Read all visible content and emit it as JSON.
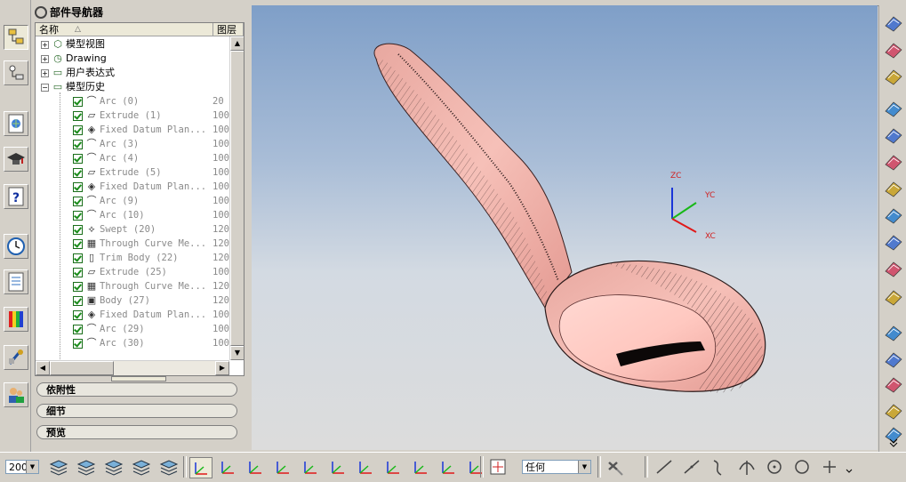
{
  "navigator": {
    "title": "部件导航器",
    "columns": {
      "name": "名称",
      "sort_indicator": "△",
      "layer": "图层"
    },
    "groups": [
      {
        "label": "模型视图",
        "expander": "+"
      },
      {
        "label": "Drawing",
        "expander": "+"
      },
      {
        "label": "用户表达式",
        "expander": "+"
      },
      {
        "label": "模型历史",
        "expander": "−"
      }
    ],
    "features": [
      {
        "name": "Arc (0)",
        "layer": "20",
        "icon": "arc-icon"
      },
      {
        "name": "Extrude (1)",
        "layer": "100",
        "icon": "extrude-icon"
      },
      {
        "name": "Fixed Datum Plan...",
        "layer": "100",
        "icon": "datum-plane-icon"
      },
      {
        "name": "Arc (3)",
        "layer": "100",
        "icon": "arc-icon"
      },
      {
        "name": "Arc (4)",
        "layer": "100",
        "icon": "arc-icon"
      },
      {
        "name": "Extrude (5)",
        "layer": "100",
        "icon": "extrude-icon"
      },
      {
        "name": "Fixed Datum Plan...",
        "layer": "100",
        "icon": "datum-plane-icon"
      },
      {
        "name": "Arc (9)",
        "layer": "100",
        "icon": "arc-icon"
      },
      {
        "name": "Arc (10)",
        "layer": "100",
        "icon": "arc-icon"
      },
      {
        "name": "Swept (20)",
        "layer": "120",
        "icon": "swept-icon"
      },
      {
        "name": "Through Curve Me...",
        "layer": "120",
        "icon": "through-curve-mesh-icon"
      },
      {
        "name": "Trim Body (22)",
        "layer": "120",
        "icon": "trim-body-icon"
      },
      {
        "name": "Extrude (25)",
        "layer": "100",
        "icon": "extrude-icon"
      },
      {
        "name": "Through Curve Me...",
        "layer": "120",
        "icon": "through-curve-mesh-icon"
      },
      {
        "name": "Body (27)",
        "layer": "120",
        "icon": "body-icon"
      },
      {
        "name": "Fixed Datum Plan...",
        "layer": "100",
        "icon": "datum-plane-icon"
      },
      {
        "name": "Arc (29)",
        "layer": "100",
        "icon": "arc-icon"
      },
      {
        "name": "Arc (30)",
        "layer": "100",
        "icon": "arc-icon"
      }
    ],
    "sections": [
      "依附性",
      "细节",
      "预览"
    ]
  },
  "viewport": {
    "csys_labels": {
      "z": "ZC",
      "y": "YC",
      "x": "XC"
    },
    "axis_colors": {
      "z": "#1a35d8",
      "y": "#18b818",
      "x": "#e01818"
    },
    "model_color": "#f2b0a8"
  },
  "bottom_toolbar": {
    "zoom_value": "200",
    "filter_value": "任何"
  },
  "colors": {
    "ui_gray": "#d4d0c8",
    "check_green": "#1a8c1a"
  }
}
